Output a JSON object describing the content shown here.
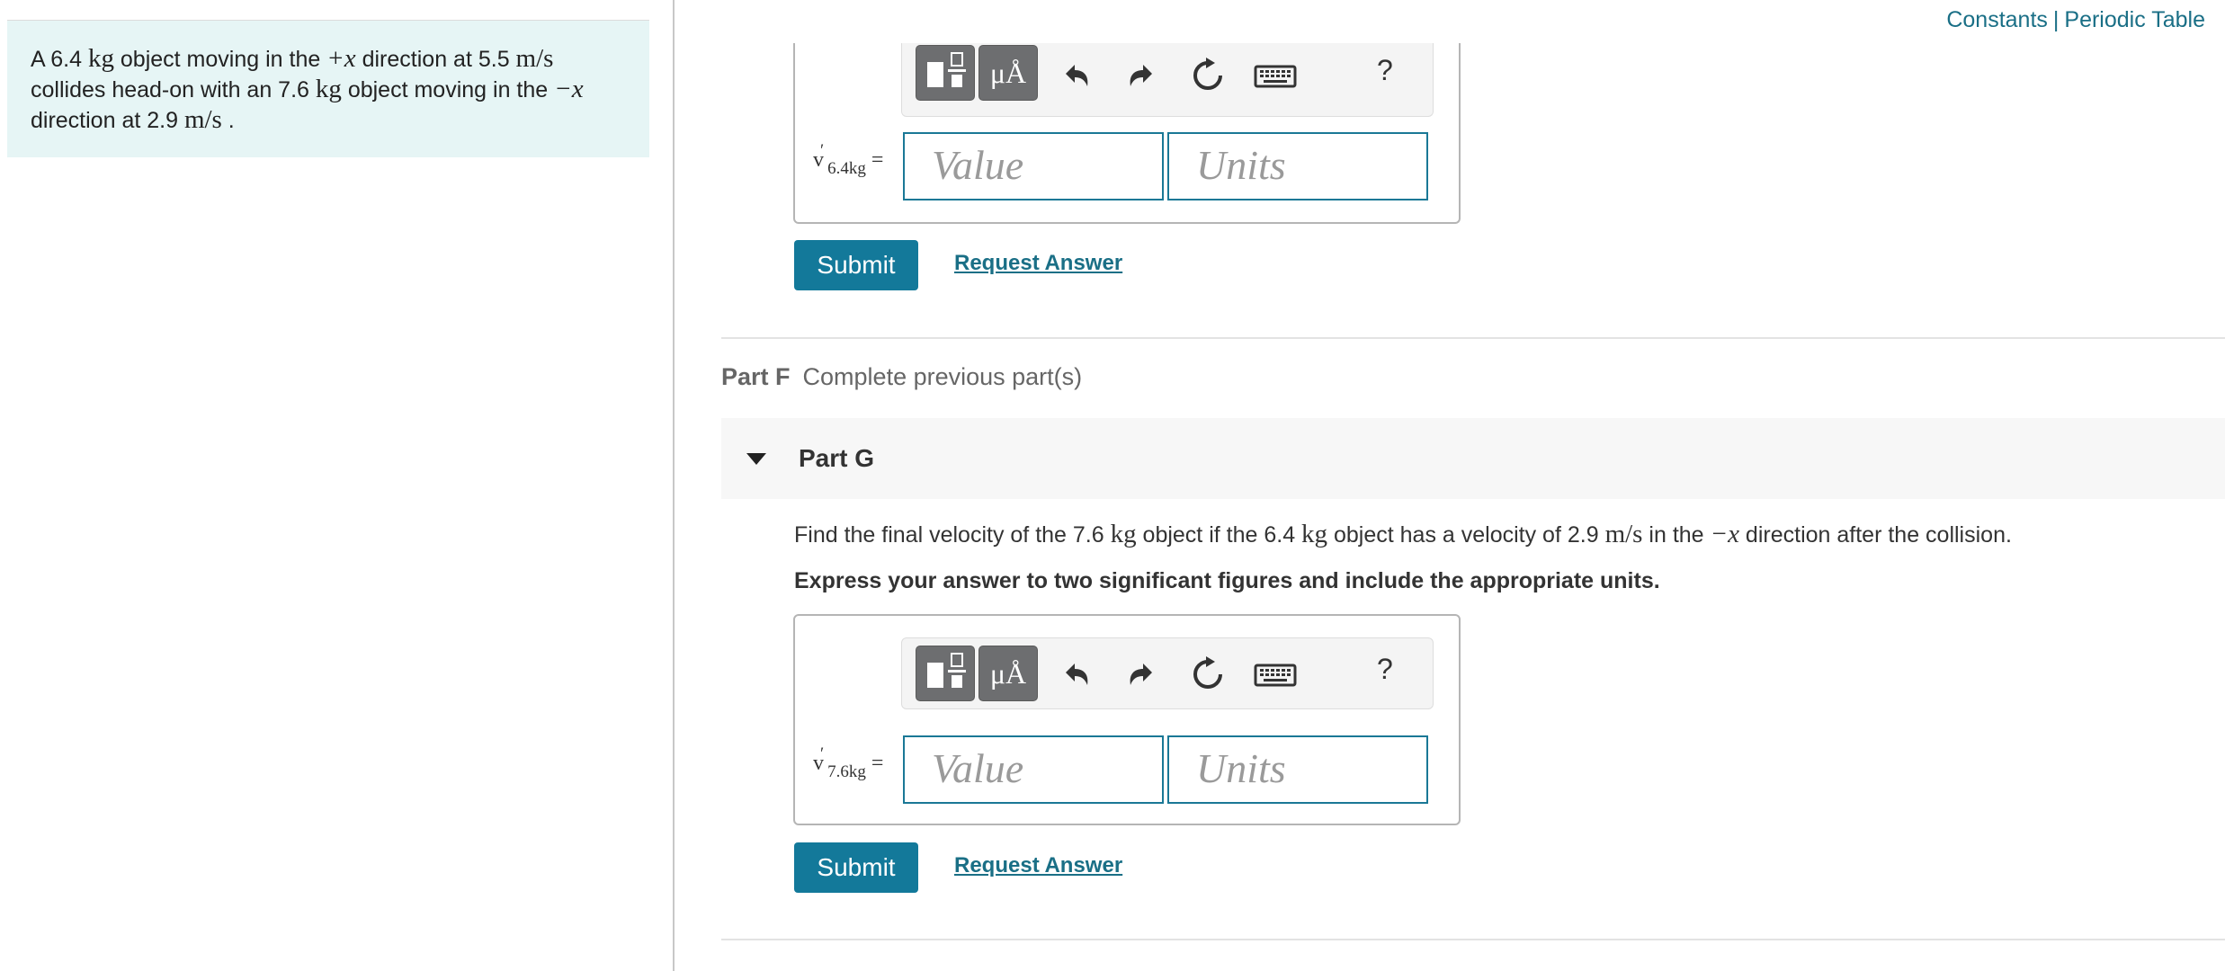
{
  "header": {
    "constants_link": "Constants",
    "separator": "|",
    "periodic_table_link": "Periodic Table"
  },
  "problem": {
    "t1": "A 6.4 ",
    "kg1": "kg",
    "t2": " object moving in the ",
    "plusx": "+x",
    "t3": " direction at 5.5 ",
    "ms1": "m/s",
    "t4": "collides head-on with an 7.6 ",
    "kg2": "kg",
    "t5": " object moving in the ",
    "minusx": "−x",
    "t6": "direction at 2.9 ",
    "ms2": "m/s",
    "t7": " ."
  },
  "toolbar": {
    "units_button": "μÅ",
    "help_label": "?"
  },
  "part_e": {
    "variable": "v",
    "prime": "′",
    "subscript": "6.4kg",
    "equals": "=",
    "value_placeholder": "Value",
    "units_placeholder": "Units",
    "submit_label": "Submit",
    "request_answer_label": "Request Answer"
  },
  "part_f": {
    "label": "Part F",
    "status": "Complete previous part(s)"
  },
  "part_g": {
    "label": "Part G",
    "q1": "Find the final velocity of the 7.6 ",
    "qkg1": "kg",
    "q2": " object if the 6.4 ",
    "qkg2": "kg",
    "q3": " object has a velocity of 2.9 ",
    "qms": "m/s",
    "q4": " in the ",
    "qminusx": "−x",
    "q5": " direction after the collision.",
    "instruction": "Express your answer to two significant figures and include the appropriate units.",
    "variable": "v",
    "prime": "′",
    "subscript": "7.6kg",
    "equals": "=",
    "value_placeholder": "Value",
    "units_placeholder": "Units",
    "submit_label": "Submit",
    "request_answer_label": "Request Answer"
  },
  "colors": {
    "accent": "#13799a",
    "link": "#1a6f86",
    "problem_bg": "#e6f5f5",
    "input_border": "#1a7896"
  }
}
